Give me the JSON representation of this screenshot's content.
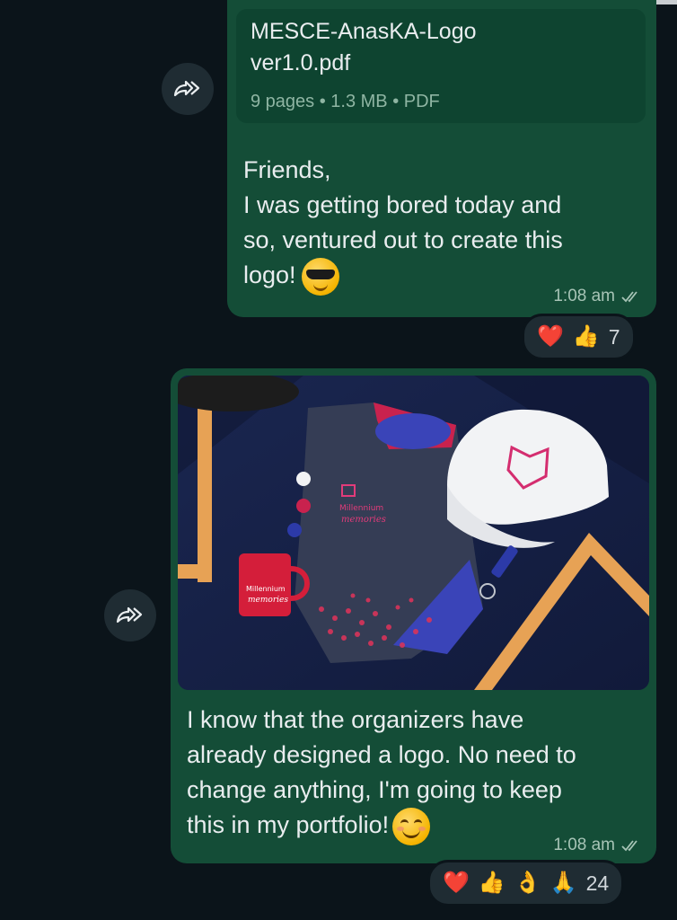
{
  "status_bar": {},
  "messages": [
    {
      "document": {
        "name_line1": "MESCE-AnasKA-Logo",
        "name_line2": "ver1.0.pdf",
        "meta": "9 pages • 1.3 MB • PDF"
      },
      "text_line1": "Friends,",
      "text_line2": "I was getting bored today and",
      "text_line3": "so, ventured out to create this",
      "text_line4": "logo!",
      "emoji": "smiling-face-with-sunglasses",
      "time": "1:08 am",
      "read_status": "double-check",
      "reactions": {
        "emojis": [
          "❤️",
          "👍"
        ],
        "count": "7"
      }
    },
    {
      "image": {
        "brand_text_line1": "Millennium",
        "brand_text_line2": "memories"
      },
      "text_line1": "I know that the organizers have",
      "text_line2": "already designed a logo. No need to",
      "text_line3": "change anything, I'm going to keep",
      "text_line4": "this in my portfolio!",
      "emoji": "smiling-face-with-smiling-eyes",
      "time": "1:08 am",
      "read_status": "double-check",
      "reactions": {
        "emojis": [
          "❤️",
          "👍",
          "👌",
          "🙏"
        ],
        "count": "24"
      }
    }
  ],
  "colors": {
    "background": "#0b141a",
    "bubble_outgoing": "#144d37",
    "reaction_pill": "#1f2c33",
    "forward_button": "#1f2c33"
  }
}
